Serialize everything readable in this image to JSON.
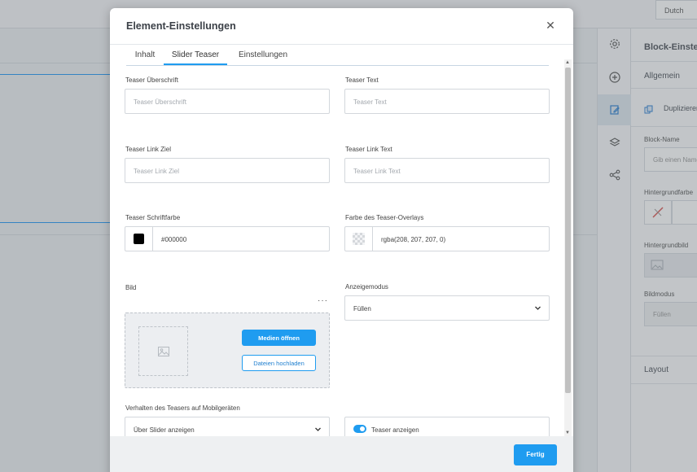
{
  "background": {
    "language": "Dutch",
    "panel": {
      "title": "Block-Einstellungen",
      "section_general": "Allgemein",
      "duplicate": "Duplizieren",
      "block_name_label": "Block-Name",
      "block_name_placeholder": "Gib einen Namen ein",
      "bg_color_label": "Hintergrundfarbe",
      "bg_image_label": "Hintergrundbild",
      "image_mode_label": "Bildmodus",
      "image_mode_value": "Füllen",
      "layout": "Layout"
    }
  },
  "modal": {
    "title": "Element-Einstellungen",
    "close_icon": "close-icon",
    "tabs": [
      {
        "label": "Inhalt"
      },
      {
        "label": "Slider Teaser",
        "active": true
      },
      {
        "label": "Einstellungen"
      }
    ],
    "fields": {
      "teaser_heading": {
        "label": "Teaser Überschrift",
        "placeholder": "Teaser Überschrift"
      },
      "teaser_text": {
        "label": "Teaser Text",
        "placeholder": "Teaser Text"
      },
      "teaser_link_target": {
        "label": "Teaser Link Ziel",
        "placeholder": "Teaser Link Ziel"
      },
      "teaser_link_text": {
        "label": "Teaser Link Text",
        "placeholder": "Teaser Link Text"
      },
      "font_color": {
        "label": "Teaser Schriftfarbe",
        "value": "#000000",
        "swatch": "#000000"
      },
      "overlay_color": {
        "label": "Farbe des Teaser-Overlays",
        "value": "rgba(208, 207, 207, 0)"
      },
      "image": {
        "label": "Bild",
        "more": "···",
        "open_media": "Medien öffnen",
        "upload_files": "Dateien hochladen"
      },
      "display_mode": {
        "label": "Anzeigemodus",
        "value": "Füllen"
      },
      "mobile_behavior": {
        "label": "Verhalten des Teasers auf Mobilgeräten",
        "value": "Über Slider anzeigen"
      },
      "show_teaser": {
        "label": "Teaser anzeigen",
        "on": true
      }
    },
    "footer": {
      "done": "Fertig"
    }
  },
  "colors": {
    "accent": "#1f9cf0"
  }
}
